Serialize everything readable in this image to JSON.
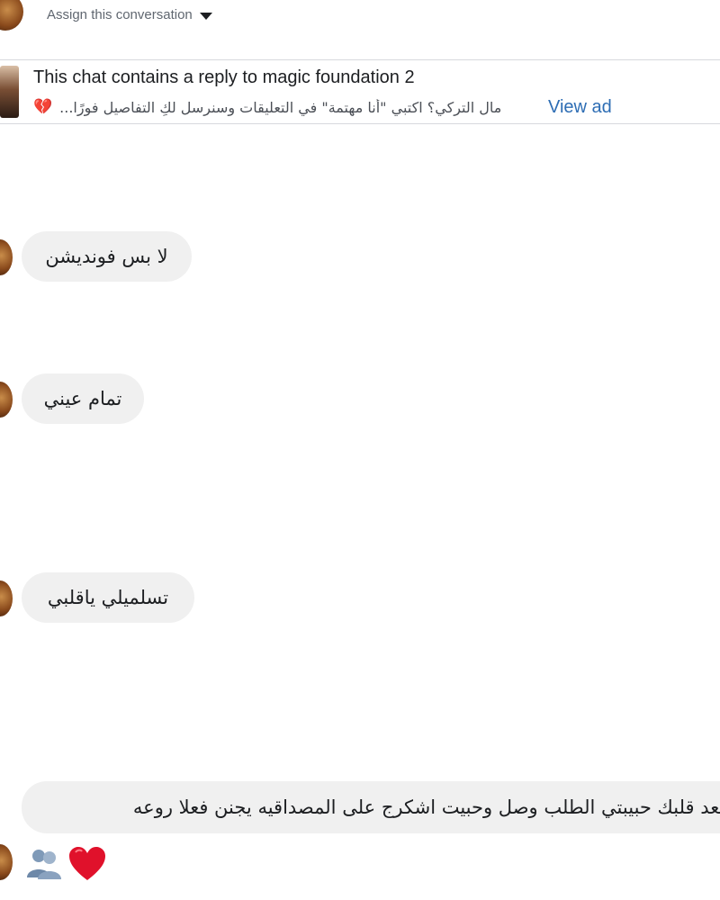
{
  "header": {
    "assign_label": "Assign this conversation"
  },
  "ad_banner": {
    "title": "This chat contains a reply to magic foundation 2",
    "snippet": "مال التركي؟ اكتبي \"أنا مهتمة\" في التعليقات وسنرسل لكِ التفاصيل فورًا...",
    "view_ad_label": "View ad",
    "heart_icon": "broken-heart-icon"
  },
  "messages": [
    {
      "text": "لا بس فونديشن"
    },
    {
      "text": "تمام عيني"
    },
    {
      "text": "تسلميلي ياقلبي"
    },
    {
      "text": "يسعد قلبك حبيبتي الطلب وصل وحبيت اشكرج على المصداقيه يجنن فعلا روعه"
    }
  ],
  "emoji_reply": {
    "icons": [
      "people-icon",
      "red-heart-icon"
    ]
  },
  "colors": {
    "bubble_bg": "#f0f0f0",
    "link": "#2d6db4",
    "text": "#1c1e21",
    "muted": "#606770"
  }
}
